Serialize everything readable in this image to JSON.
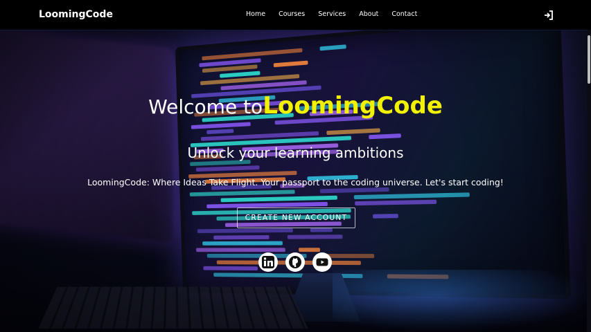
{
  "navbar": {
    "brand": "LoomingCode",
    "links": [
      "Home",
      "Courses",
      "Services",
      "About",
      "Contact"
    ],
    "login_icon": "sign-in-icon"
  },
  "hero": {
    "welcome_prefix": "Welcome to",
    "brand_highlight": "LoomingCode",
    "subheading": "Unlock your learning ambitions",
    "tagline": "LoomingCode: Where Ideas Take Flight. Your passport to the coding universe. Let's start coding!",
    "cta_label": "CREATE NEW ACCOUNT"
  },
  "socials": [
    {
      "icon": "linkedin-icon"
    },
    {
      "icon": "github-icon"
    },
    {
      "icon": "youtube-icon"
    }
  ],
  "colors": {
    "accent": "#f2f200",
    "navbar_bg": "#000000",
    "text": "#ffffff"
  }
}
